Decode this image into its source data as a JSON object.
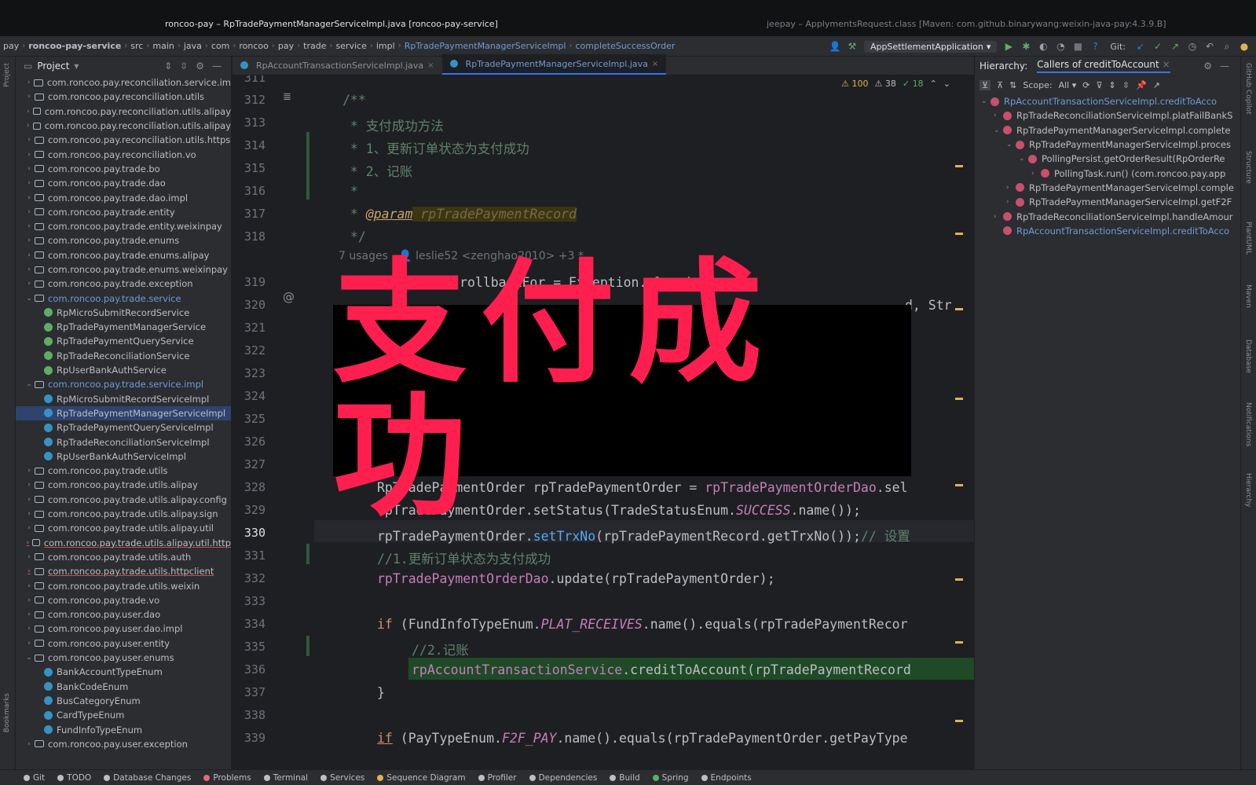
{
  "window": {
    "title_left": "roncoo-pay – RpTradePaymentManagerServiceImpl.java [roncoo-pay-service]",
    "title_right": "jeepay – ApplymentsRequest.class [Maven: com.github.binarywang:weixin-java-pay:4.3.9.B]"
  },
  "breadcrumb": {
    "items": [
      "pay",
      "roncoo-pay-service",
      "src",
      "main",
      "java",
      "com",
      "roncoo",
      "pay",
      "trade",
      "service",
      "impl"
    ],
    "class_item": "RpTradePaymentManagerServiceImpl",
    "method_item": "completeSuccessOrder"
  },
  "toolbar": {
    "run_config": "AppSettlementApplication",
    "git_label": "Git:"
  },
  "project_panel": {
    "title": "Project",
    "rows": [
      {
        "text": "com.roncoo.pay.reconciliation.service.im",
        "kind": "folder",
        "arrow": "›"
      },
      {
        "text": "com.roncoo.pay.reconciliation.utils",
        "kind": "folder",
        "arrow": "›"
      },
      {
        "text": "com.roncoo.pay.reconciliation.utils.alipay",
        "kind": "folder",
        "arrow": "›"
      },
      {
        "text": "com.roncoo.pay.reconciliation.utils.alipay",
        "kind": "folder",
        "arrow": "›"
      },
      {
        "text": "com.roncoo.pay.reconciliation.utils.https",
        "kind": "folder",
        "arrow": "›"
      },
      {
        "text": "com.roncoo.pay.reconciliation.vo",
        "kind": "folder",
        "arrow": "›"
      },
      {
        "text": "com.roncoo.pay.trade.bo",
        "kind": "folder",
        "arrow": "›"
      },
      {
        "text": "com.roncoo.pay.trade.dao",
        "kind": "folder",
        "arrow": "›"
      },
      {
        "text": "com.roncoo.pay.trade.dao.impl",
        "kind": "folder",
        "arrow": "›"
      },
      {
        "text": "com.roncoo.pay.trade.entity",
        "kind": "folder",
        "arrow": "›"
      },
      {
        "text": "com.roncoo.pay.trade.entity.weixinpay",
        "kind": "folder",
        "arrow": "›"
      },
      {
        "text": "com.roncoo.pay.trade.enums",
        "kind": "folder",
        "arrow": "›"
      },
      {
        "text": "com.roncoo.pay.trade.enums.alipay",
        "kind": "folder",
        "arrow": "›"
      },
      {
        "text": "com.roncoo.pay.trade.enums.weixinpay",
        "kind": "folder",
        "arrow": "›"
      },
      {
        "text": "com.roncoo.pay.trade.exception",
        "kind": "folder",
        "arrow": "›"
      },
      {
        "text": "com.roncoo.pay.trade.service",
        "kind": "folder",
        "arrow": "⌄",
        "blue": true
      },
      {
        "text": "RpMicroSubmitRecordService",
        "kind": "iface",
        "indent": 2
      },
      {
        "text": "RpTradePaymentManagerService",
        "kind": "iface",
        "indent": 2
      },
      {
        "text": "RpTradePaymentQueryService",
        "kind": "iface",
        "indent": 2
      },
      {
        "text": "RpTradeReconciliationService",
        "kind": "iface",
        "indent": 2
      },
      {
        "text": "RpUserBankAuthService",
        "kind": "iface",
        "indent": 2
      },
      {
        "text": "com.roncoo.pay.trade.service.impl",
        "kind": "folder",
        "arrow": "⌄",
        "blue": true
      },
      {
        "text": "RpMicroSubmitRecordServiceImpl",
        "kind": "cls",
        "indent": 2
      },
      {
        "text": "RpTradePaymentManagerServiceImpl",
        "kind": "cls",
        "indent": 2,
        "selected": true
      },
      {
        "text": "RpTradePaymentQueryServiceImpl",
        "kind": "cls",
        "indent": 2
      },
      {
        "text": "RpTradeReconciliationServiceImpl",
        "kind": "cls",
        "indent": 2
      },
      {
        "text": "RpUserBankAuthServiceImpl",
        "kind": "cls",
        "indent": 2
      },
      {
        "text": "com.roncoo.pay.trade.utils",
        "kind": "folder",
        "arrow": "›"
      },
      {
        "text": "com.roncoo.pay.trade.utils.alipay",
        "kind": "folder",
        "arrow": "›"
      },
      {
        "text": "com.roncoo.pay.trade.utils.alipay.config",
        "kind": "folder",
        "arrow": "›"
      },
      {
        "text": "com.roncoo.pay.trade.utils.alipay.sign",
        "kind": "folder",
        "arrow": "›"
      },
      {
        "text": "com.roncoo.pay.trade.utils.alipay.util",
        "kind": "folder",
        "arrow": "›"
      },
      {
        "text": "com.roncoo.pay.trade.utils.alipay.util.http",
        "kind": "folder",
        "arrow": "›",
        "underline": true
      },
      {
        "text": "com.roncoo.pay.trade.utils.auth",
        "kind": "folder",
        "arrow": "›"
      },
      {
        "text": "com.roncoo.pay.trade.utils.httpclient",
        "kind": "folder",
        "arrow": "›",
        "underline": true
      },
      {
        "text": "com.roncoo.pay.trade.utils.weixin",
        "kind": "folder",
        "arrow": "›"
      },
      {
        "text": "com.roncoo.pay.trade.vo",
        "kind": "folder",
        "arrow": "›"
      },
      {
        "text": "com.roncoo.pay.user.dao",
        "kind": "folder",
        "arrow": "›"
      },
      {
        "text": "com.roncoo.pay.user.dao.impl",
        "kind": "folder",
        "arrow": "›"
      },
      {
        "text": "com.roncoo.pay.user.entity",
        "kind": "folder",
        "arrow": "›"
      },
      {
        "text": "com.roncoo.pay.user.enums",
        "kind": "folder",
        "arrow": "⌄"
      },
      {
        "text": "BankAccountTypeEnum",
        "kind": "cls",
        "indent": 2
      },
      {
        "text": "BankCodeEnum",
        "kind": "cls",
        "indent": 2
      },
      {
        "text": "BusCategoryEnum",
        "kind": "cls",
        "indent": 2
      },
      {
        "text": "CardTypeEnum",
        "kind": "cls",
        "indent": 2
      },
      {
        "text": "FundInfoTypeEnum",
        "kind": "cls",
        "indent": 2
      },
      {
        "text": "com.roncoo.pay.user.exception",
        "kind": "folder",
        "arrow": "›"
      }
    ]
  },
  "editor_tabs": [
    {
      "label": "RpAccountTransactionServiceImpl.java",
      "active": false
    },
    {
      "label": "RpTradePaymentManagerServiceImpl.java",
      "active": true
    }
  ],
  "inspections": {
    "warnings": "100",
    "weak": "38",
    "ok": "18"
  },
  "code": {
    "usages_hint": "7 usages",
    "author_hint": "leslie52 <zenghao2010> +3 *",
    "line_numbers": [
      "311",
      "312",
      "313",
      "314",
      "315",
      "316",
      "317",
      "318",
      "319",
      "320",
      "321",
      "322",
      "323",
      "324",
      "325",
      "326",
      "327",
      "328",
      "329",
      "330",
      "331",
      "332",
      "333",
      "334",
      "335",
      "336",
      "337",
      "338",
      "339"
    ],
    "lines": {
      "l312": "/**",
      "l313": " * 支付成功方法",
      "l314": " * 1、更新订单状态为支付成功",
      "l315": " * 2、记账",
      "l316": " *",
      "l317a": " * ",
      "l317b": "@param",
      "l317c": " rpTradePaymentRecord",
      "l318": " */",
      "l319a": "@Transactional",
      "l319b": "(rollbackFor = Exception.",
      "l319c": "class",
      "l319d": ")",
      "l320": "d, Str",
      "l325": ";",
      "l328a": "RpTradePaymentOrder rpTradePaymentOrder = ",
      "l328b": "rpTradePaymentOrderDao",
      "l328c": ".sel",
      "l329a": "rpTradePaymentOrder.setStatus(TradeStatusEnum.",
      "l329b": "SUCCESS",
      "l329c": ".name());",
      "l330a": "rpTradePaymentOrder.",
      "l330b": "setTrxNo",
      "l330c": "(rpTradePaymentRecord.getTrxNo());",
      "l330d": "// 设置",
      "l331": "//1.更新订单状态为支付成功",
      "l332a": "rpTradePaymentOrderDao",
      "l332b": ".update(rpTradePaymentOrder);",
      "l334a": "if",
      "l334b": " (FundInfoTypeEnum.",
      "l334c": "PLAT_RECEIVES",
      "l334d": ".name().equals(rpTradePaymentRecor",
      "l335": "//2.记账",
      "l336a": "rpAccountTransactionService",
      "l336b": ".creditToAccount(rpTradePaymentRecord",
      "l337": "}",
      "l339a": "if",
      "l339b": " (PayTypeEnum.",
      "l339c": "F2F_PAY",
      "l339d": ".name().equals(rpTradePaymentOrder.getPayType"
    }
  },
  "overlay_caption": "支付成功",
  "hierarchy": {
    "title": "Hierarchy:",
    "tab": "Callers of creditToAccount",
    "scope_label": "Scope:",
    "scope_value": "All",
    "rows": [
      {
        "text": "RpAccountTransactionServiceImpl.creditToAcco",
        "depth": 0,
        "sel": true,
        "arrow": "⌄"
      },
      {
        "text": "RpTradeReconciliationServiceImpl.platFailBankS",
        "depth": 1,
        "arrow": "›"
      },
      {
        "text": "RpTradePaymentManagerServiceImpl.complete",
        "depth": 1,
        "arrow": "⌄"
      },
      {
        "text": "RpTradePaymentManagerServiceImpl.proces",
        "depth": 2,
        "arrow": "⌄"
      },
      {
        "text": "PollingPersist.getOrderResult(RpOrderRe",
        "depth": 3,
        "arrow": "⌄"
      },
      {
        "text": "PollingTask.run()  (com.roncoo.pay.app",
        "depth": 4,
        "arrow": "›"
      },
      {
        "text": "RpTradePaymentManagerServiceImpl.comple",
        "depth": 2,
        "arrow": "›"
      },
      {
        "text": "RpTradePaymentManagerServiceImpl.getF2F",
        "depth": 2,
        "arrow": "›"
      },
      {
        "text": "RpTradeReconciliationServiceImpl.handleAmour",
        "depth": 1,
        "arrow": "›"
      },
      {
        "text": "RpAccountTransactionServiceImpl.creditToAcco",
        "depth": 1,
        "sel": true,
        "arrow": ""
      }
    ]
  },
  "right_strip": [
    "GitHub Copilot",
    "Structure",
    "PlantUML",
    "Maven",
    "Database",
    "Notifications",
    "Hierarchy"
  ],
  "left_strip": [
    "Project",
    "Bookmarks"
  ],
  "statusbar": [
    {
      "label": "Git",
      "color": "#bcbec4"
    },
    {
      "label": "TODO",
      "color": "#bcbec4"
    },
    {
      "label": "Database Changes",
      "color": "#bcbec4"
    },
    {
      "label": "Problems",
      "color": "#e06c75"
    },
    {
      "label": "Terminal",
      "color": "#bcbec4"
    },
    {
      "label": "Services",
      "color": "#bcbec4"
    },
    {
      "label": "Sequence Diagram",
      "color": "#e0b350"
    },
    {
      "label": "Profiler",
      "color": "#bcbec4"
    },
    {
      "label": "Dependencies",
      "color": "#bcbec4"
    },
    {
      "label": "Build",
      "color": "#bcbec4"
    },
    {
      "label": "Spring",
      "color": "#5fad65"
    },
    {
      "label": "Endpoints",
      "color": "#bcbec4"
    }
  ]
}
